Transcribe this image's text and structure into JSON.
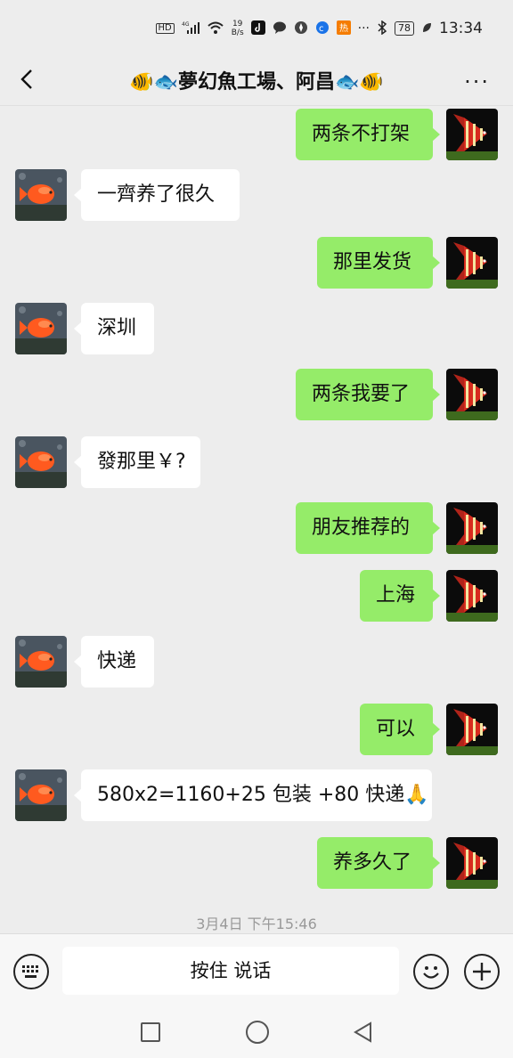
{
  "status_bar": {
    "network": "HD",
    "signal": "4G",
    "speed_value": "19",
    "speed_unit": "B/s",
    "battery": "78",
    "time": "13:34",
    "more": "···"
  },
  "header": {
    "title": "🐠🐟夢幻魚工場、阿昌🐟🐠",
    "more": "···"
  },
  "messages": [
    {
      "side": "out",
      "text": "两条不打架"
    },
    {
      "side": "in",
      "text": "一齊养了很久"
    },
    {
      "side": "out",
      "text": "那里发货"
    },
    {
      "side": "in",
      "text": "深圳"
    },
    {
      "side": "out",
      "text": "两条我要了"
    },
    {
      "side": "in",
      "text": "發那里￥?"
    },
    {
      "side": "out",
      "text": "朋友推荐的"
    },
    {
      "side": "out",
      "text": "上海"
    },
    {
      "side": "in",
      "text": "快递"
    },
    {
      "side": "out",
      "text": "可以"
    },
    {
      "side": "in",
      "text": "580x2=1160+25 包装 +80 快递🙏"
    },
    {
      "side": "out",
      "text": "养多久了"
    }
  ],
  "timestamp": "3月4日 下午15:46",
  "input_bar": {
    "voice_label": "按住 说话"
  },
  "colors": {
    "background": "#ededed",
    "bubble_out": "#95ec69",
    "bubble_in": "#ffffff"
  }
}
